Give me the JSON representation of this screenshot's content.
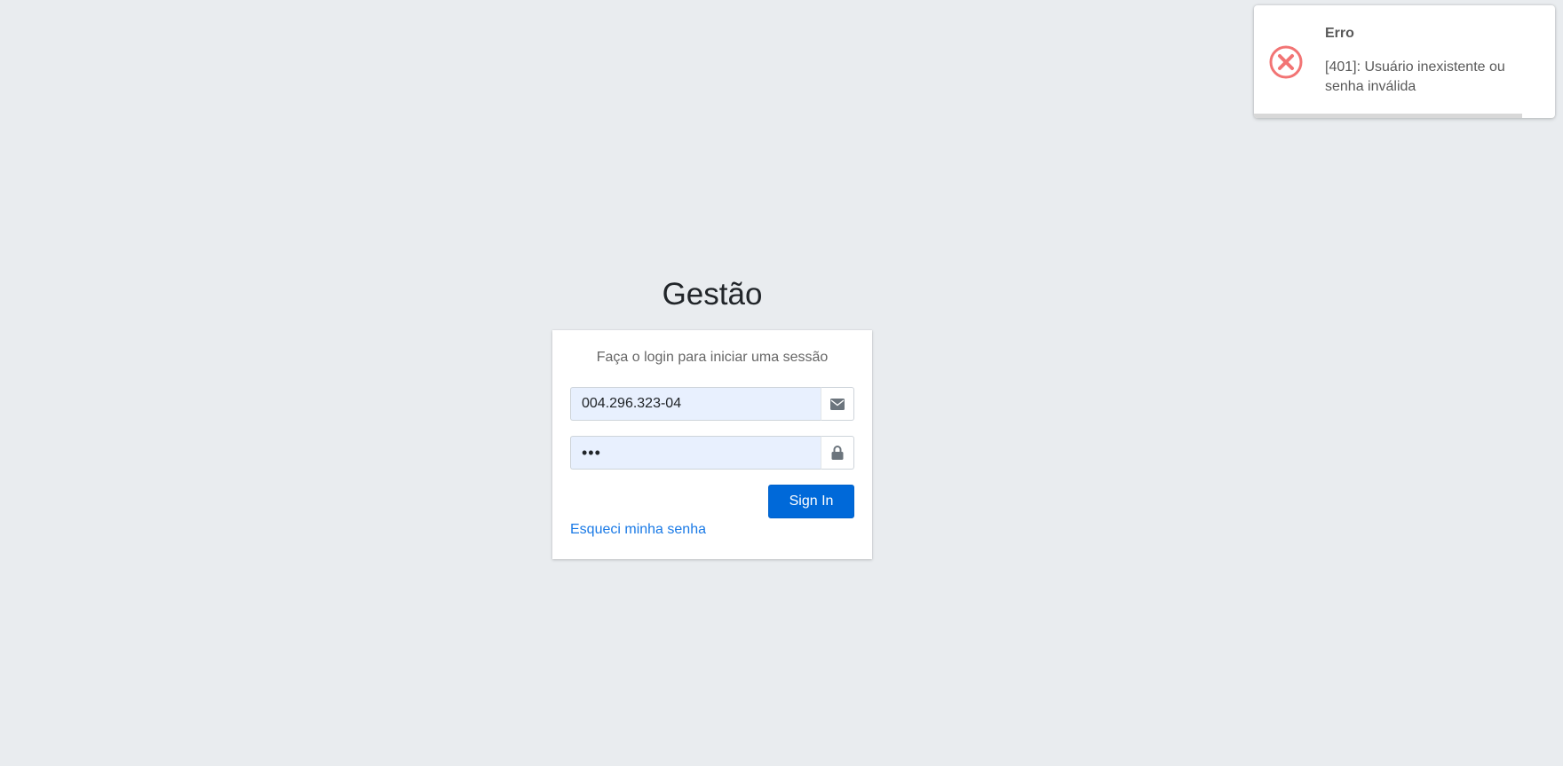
{
  "toast": {
    "title": "Erro",
    "message": "[401]: Usuário inexistente ou senha inválida",
    "icon": "error-circle-icon",
    "icon_color": "#f27474",
    "progress_remaining": 0.89
  },
  "login": {
    "logo": "Gestão",
    "message": "Faça o login para iniciar uma sessão",
    "username_value": "004.296.323-04",
    "username_icon": "envelope-icon",
    "password_value": "123",
    "password_icon": "lock-icon",
    "submit_label": "Sign In",
    "forgot_label": "Esqueci minha senha"
  },
  "colors": {
    "background": "#e9ecef",
    "primary": "#0069d9",
    "link": "#1a7ae6",
    "autofill": "#e8f0fe"
  }
}
